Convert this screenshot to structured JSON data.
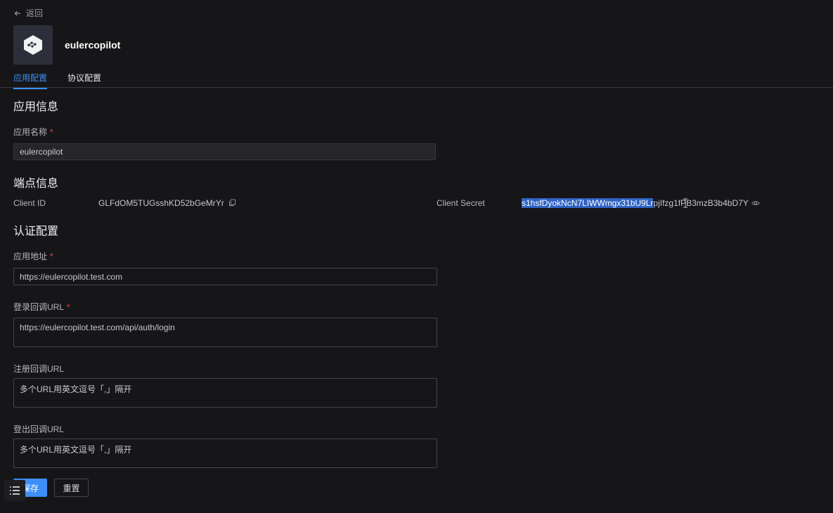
{
  "nav": {
    "back_label": "返回"
  },
  "app": {
    "name": "eulercopilot"
  },
  "tabs": [
    {
      "label": "应用配置",
      "active": true
    },
    {
      "label": "协议配置",
      "active": false
    }
  ],
  "app_info": {
    "title": "应用信息",
    "name_label": "应用名称",
    "name_value": "eulercopilot"
  },
  "endpoint": {
    "title": "端点信息",
    "client_id_label": "Client ID",
    "client_id_value": "GLFdOM5TUGsshKD52bGeMrYr",
    "client_secret_label": "Client Secret",
    "client_secret_selected": "s1hsfDyokNcN7LIWWmgx31bU9Lr",
    "client_secret_rest": "pjIfzg1fPB3mzB3b4bD7Y"
  },
  "auth": {
    "title": "认证配置",
    "app_url_label": "应用地址",
    "app_url_value": "https://eulercopilot.test.com",
    "login_cb_label": "登录回调URL",
    "login_cb_value": "https://eulercopilot.test.com/api/auth/login",
    "register_cb_label": "注册回调URL",
    "register_cb_placeholder": "多个URL用英文逗号「,」隔开",
    "logout_cb_label": "登出回调URL",
    "logout_cb_placeholder": "多个URL用英文逗号「,」隔开"
  },
  "actions": {
    "save_label": "保存",
    "reset_label": "重置"
  },
  "colors": {
    "accent": "#3d8ef7",
    "required": "#ef4444",
    "selection": "#2e63c4"
  },
  "icons": [
    "arrow-left-icon",
    "app-logo-icon",
    "copy-icon",
    "eye-icon",
    "menu-list-icon"
  ]
}
